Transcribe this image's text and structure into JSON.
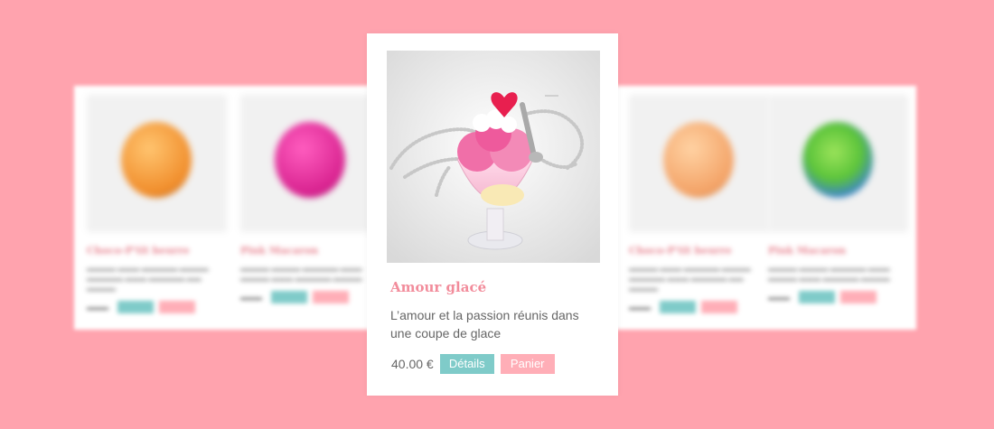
{
  "featured": {
    "title": "Amour glacé",
    "description": "L’amour et la passion réunis dans une coupe de glace",
    "price": "40.00 €",
    "details_label": "Détails",
    "cart_label": "Panier"
  },
  "background_products": [
    {
      "title": "Choco-P'tit beurre",
      "food_color": "#f6a94a"
    },
    {
      "title": "Pink Macaron",
      "food_color": "#e2329e"
    },
    {
      "title": "Choco-P'tit beurre",
      "food_color": "#f7b07a"
    },
    {
      "title": "Pink Macaron",
      "food_color": "#7ccf4a"
    }
  ],
  "colors": {
    "background": "#ffa3ae",
    "accent_teal": "#7fcbc9",
    "accent_pink": "#ffaeb7",
    "title_pink": "#f28c9b"
  }
}
